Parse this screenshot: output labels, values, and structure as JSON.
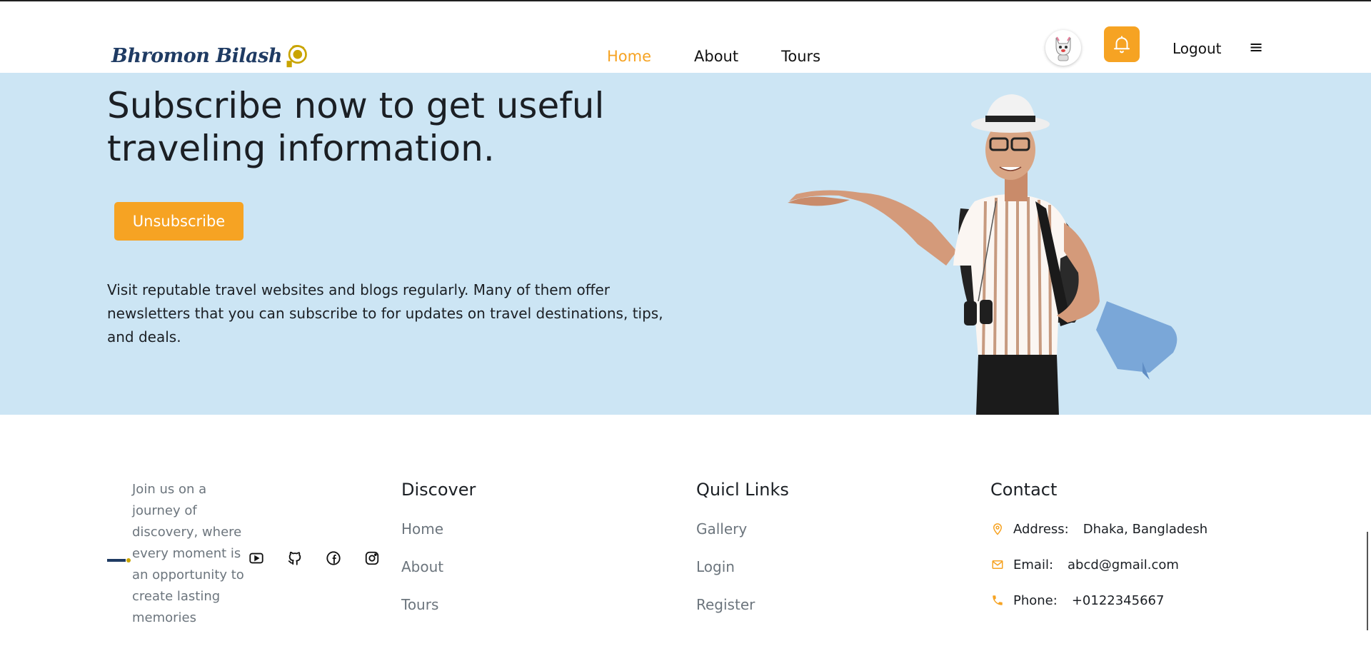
{
  "header": {
    "logo_text": "Bhromon Bilash",
    "nav": [
      {
        "label": "Home",
        "active": true
      },
      {
        "label": "About",
        "active": false
      },
      {
        "label": "Tours",
        "active": false
      }
    ],
    "logout_label": "Logout",
    "menu_glyph": "≡"
  },
  "hero": {
    "title": "Subscribe now to get useful traveling information.",
    "button_label": "Unsubscribe",
    "description": "Visit reputable travel websites and blogs regularly. Many of them offer newsletters that you can subscribe to for updates on travel destinations, tips, and deals."
  },
  "footer": {
    "tagline": "Join us on a journey of discovery, where every moment is an opportunity to create lasting memories",
    "socials": [
      "youtube-icon",
      "github-icon",
      "facebook-icon",
      "instagram-icon"
    ],
    "discover": {
      "heading": "Discover",
      "links": [
        "Home",
        "About",
        "Tours"
      ]
    },
    "quick_links": {
      "heading": "Quicl Links",
      "links": [
        "Gallery",
        "Login",
        "Register"
      ]
    },
    "contact": {
      "heading": "Contact",
      "rows": [
        {
          "icon": "location-pin-icon",
          "label": "Address:",
          "value": "Dhaka, Bangladesh"
        },
        {
          "icon": "mail-icon",
          "label": "Email:",
          "value": "abcd@gmail.com"
        },
        {
          "icon": "phone-icon",
          "label": "Phone:",
          "value": "+0122345667"
        }
      ]
    }
  },
  "colors": {
    "accent": "#f6a323",
    "hero_bg": "#cce5f4",
    "muted_text": "#6c757d"
  }
}
